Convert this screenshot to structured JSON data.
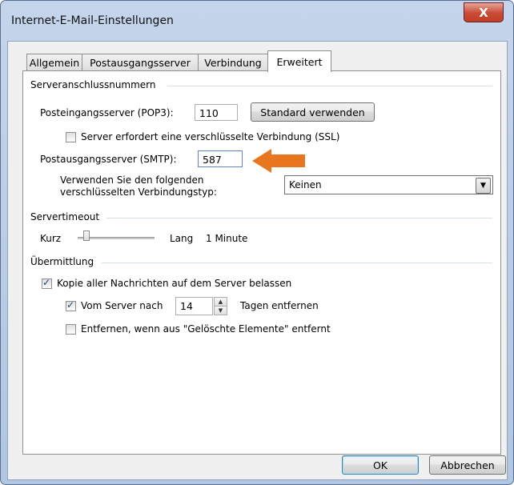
{
  "window": {
    "title": "Internet-E-Mail-Einstellungen",
    "close_glyph": "X"
  },
  "tabs": [
    {
      "label": "Allgemein",
      "active": false
    },
    {
      "label": "Postausgangsserver",
      "active": false
    },
    {
      "label": "Verbindung",
      "active": false
    },
    {
      "label": "Erweitert",
      "active": true
    }
  ],
  "sections": {
    "ports": "Serveranschlussnummern",
    "timeout": "Servertimeout",
    "delivery": "Übermittlung"
  },
  "ports": {
    "incoming_label": "Posteingangsserver (POP3):",
    "incoming_value": "110",
    "default_button": "Standard verwenden",
    "ssl_label": "Server erfordert eine verschlüsselte Verbindung (SSL)",
    "ssl_checked": false,
    "outgoing_label": "Postausgangsserver (SMTP):",
    "outgoing_value": "587",
    "encryption_label_line1": "Verwenden Sie den folgenden",
    "encryption_label_line2": "verschlüsselten Verbindungstyp:",
    "encryption_value": "Keinen"
  },
  "timeout": {
    "short_label": "Kurz",
    "long_label": "Lang",
    "value": "1 Minute",
    "slider_level": 0.1
  },
  "delivery": {
    "keep_copy_label": "Kopie aller Nachrichten auf dem Server belassen",
    "keep_copy_checked": true,
    "remove_after_label": "Vom Server nach",
    "remove_after_checked": true,
    "remove_after_days": "14",
    "remove_after_suffix": "Tagen entfernen",
    "remove_deleted_label": "Entfernen, wenn aus \"Gelöschte Elemente\" entfernt",
    "remove_deleted_checked": false
  },
  "footer": {
    "ok": "OK",
    "cancel": "Abbrechen"
  },
  "colors": {
    "annotation_arrow": "#e8761e",
    "ok_button_border": "#3c7fb1"
  }
}
